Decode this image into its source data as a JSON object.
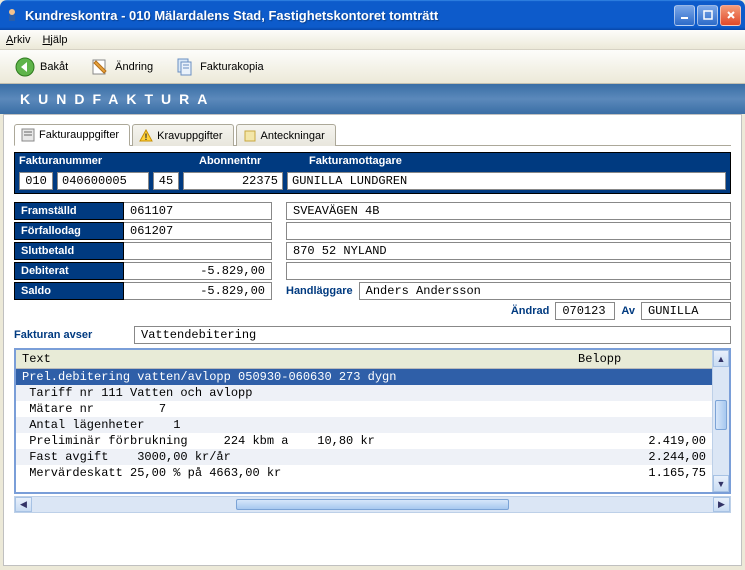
{
  "window": {
    "title": "Kundreskontra  -  010 Mälardalens Stad, Fastighetskontoret tomträtt"
  },
  "menu": {
    "arkiv": "Arkiv",
    "hjalp": "Hjälp"
  },
  "toolbar": {
    "bakat": "Bakåt",
    "andring": "Ändring",
    "fakturakopia": "Fakturakopia"
  },
  "banner": "KUNDFAKTURA",
  "tabs": {
    "fakturauppgifter": "Fakturauppgifter",
    "kravuppgifter": "Kravuppgifter",
    "anteckningar": "Anteckningar"
  },
  "header": {
    "col1": "Fakturanummer",
    "col2": "Abonnentnr",
    "col3": "Fakturamottagare",
    "faknr1": "010",
    "faknr2": "040600005",
    "faknr3": "45",
    "abonnentnr": "22375",
    "mottagare": "GUNILLA LUNDGREN"
  },
  "left": {
    "framstalld": {
      "lbl": "Framställd",
      "val": "061107"
    },
    "forfallodag": {
      "lbl": "Förfallodag",
      "val": "061207"
    },
    "slutbetald": {
      "lbl": "Slutbetald",
      "val": ""
    },
    "debiterat": {
      "lbl": "Debiterat",
      "val": "-5.829,00"
    },
    "saldo": {
      "lbl": "Saldo",
      "val": "-5.829,00"
    }
  },
  "right": {
    "addr1": "SVEAVÄGEN 4B",
    "addr2": "",
    "addr3": "870 52  NYLAND",
    "addr4": "",
    "handlaggare_lbl": "Handläggare",
    "handlaggare": "Anders Andersson",
    "andrad_lbl": "Ändrad",
    "andrad": "070123",
    "av_lbl": "Av",
    "av": "GUNILLA"
  },
  "avser": {
    "lbl": "Fakturan avser",
    "val": "Vattendebitering"
  },
  "list": {
    "h1": "Text",
    "h2": "Belopp",
    "rows": [
      {
        "text": "Prel.debitering vatten/avlopp 050930-060630 273 dygn",
        "belopp": "",
        "sel": true
      },
      {
        "text": " Tariff nr 111 Vatten och avlopp",
        "belopp": ""
      },
      {
        "text": " Mätare nr         7",
        "belopp": ""
      },
      {
        "text": " Antal lägenheter    1",
        "belopp": ""
      },
      {
        "text": " Preliminär förbrukning     224 kbm a    10,80 kr",
        "belopp": "2.419,00"
      },
      {
        "text": " Fast avgift    3000,00 kr/år",
        "belopp": "2.244,00"
      },
      {
        "text": " Mervärdeskatt 25,00 % på 4663,00 kr",
        "belopp": "1.165,75"
      }
    ]
  }
}
